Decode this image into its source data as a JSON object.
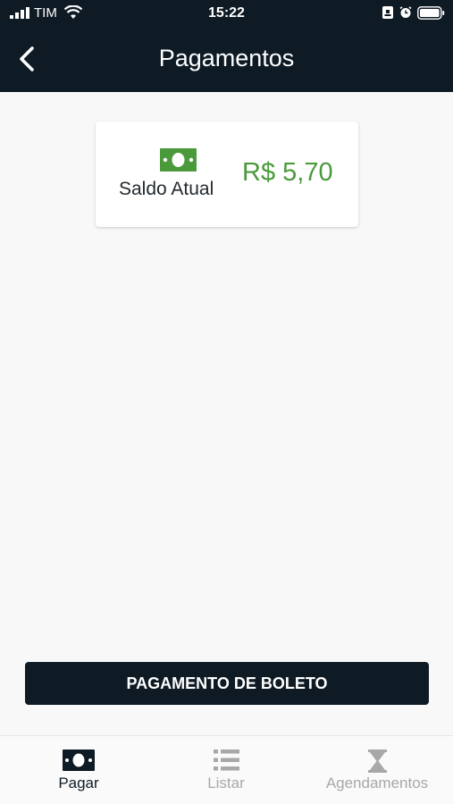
{
  "status_bar": {
    "carrier": "TIM",
    "time": "15:22"
  },
  "header": {
    "title": "Pagamentos"
  },
  "balance": {
    "label": "Saldo Atual",
    "value": "R$ 5,70"
  },
  "actions": {
    "pay_boleto": "PAGAMENTO DE BOLETO"
  },
  "nav": {
    "items": [
      {
        "label": "Pagar",
        "icon": "money-icon",
        "active": true
      },
      {
        "label": "Listar",
        "icon": "list-icon",
        "active": false
      },
      {
        "label": "Agendamentos",
        "icon": "hourglass-icon",
        "active": false
      }
    ]
  },
  "colors": {
    "header": "#0e1a24",
    "accent_green": "#4a9a3c",
    "inactive": "#a8a8a8"
  }
}
